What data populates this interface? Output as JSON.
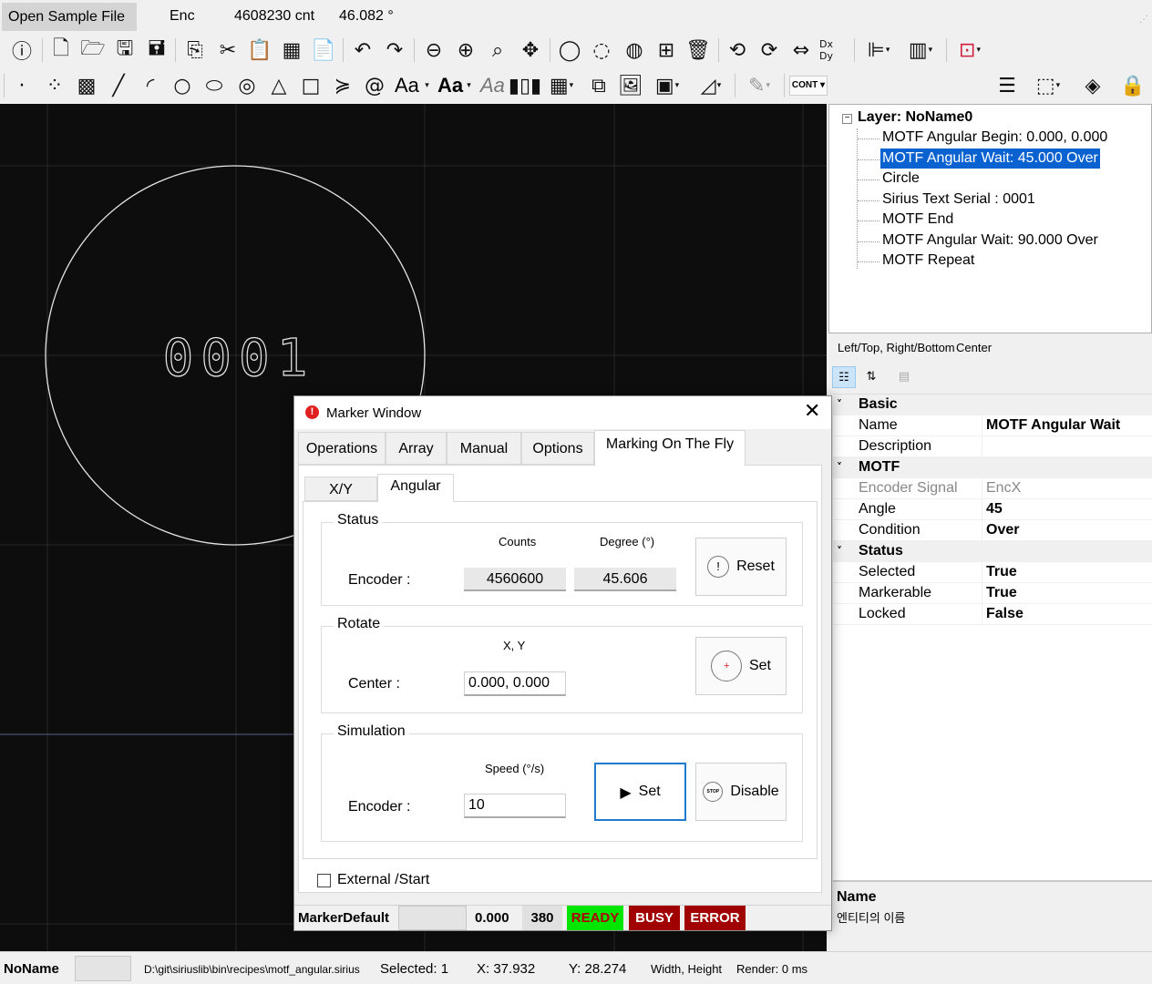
{
  "top": {
    "open_button": "Open Sample File",
    "enc_label": "Enc",
    "enc_count": "4608230 cnt",
    "enc_angle": "46.082 °"
  },
  "toolbar1": {
    "icons": [
      "info-icon",
      "new-file-icon",
      "open-folder-icon",
      "save-icon",
      "save-as-icon",
      "copy-icon",
      "cut-icon",
      "paste-icon",
      "paste-array-icon",
      "clipboard-icon",
      "undo-icon",
      "redo-icon",
      "zoom-out-icon",
      "zoom-in-icon",
      "zoom-fit-icon",
      "pan-icon",
      "select-circle-icon",
      "lasso-icon",
      "hatch-icon",
      "group-icon",
      "delete-icon",
      "rotate-ccw-icon",
      "rotate-cw-icon",
      "mirror-icon",
      "dxdy-icon",
      "align-icon",
      "distribute-icon",
      "stop-icon"
    ],
    "dxdy_label": "Dx Dy"
  },
  "toolbar2": {
    "text_tools": [
      "Aa",
      "Aa",
      "Aa"
    ],
    "cont_label": "CONT"
  },
  "canvas": {
    "text": "0001",
    "colors": {
      "bg": "#0d0d0d",
      "stroke": "#e6e6e6",
      "grid": "#262626",
      "axis": "#5b5f8a"
    }
  },
  "tree": {
    "root": "Layer: NoName0",
    "items": [
      {
        "label": "MOTF Angular Begin: 0.000, 0.000",
        "selected": false
      },
      {
        "label": "MOTF Angular Wait: 45.000 Over",
        "selected": true
      },
      {
        "label": "Circle",
        "selected": false
      },
      {
        "label": "Sirius Text Serial : 0001",
        "selected": false
      },
      {
        "label": "MOTF End",
        "selected": false
      },
      {
        "label": "MOTF Angular Wait: 90.000 Over",
        "selected": false
      },
      {
        "label": "MOTF Repeat",
        "selected": false
      }
    ]
  },
  "prop_header": {
    "a": "Left/Top, Right/Bottom",
    "b": "Center"
  },
  "props": {
    "basic": "Basic",
    "name_k": "Name",
    "name_v": "MOTF Angular Wait",
    "desc_k": "Description",
    "desc_v": "",
    "motf": "MOTF",
    "enc_k": "Encoder Signal",
    "enc_v": "EncX",
    "angle_k": "Angle",
    "angle_v": "45",
    "cond_k": "Condition",
    "cond_v": "Over",
    "status": "Status",
    "sel_k": "Selected",
    "sel_v": "True",
    "mark_k": "Markerable",
    "mark_v": "True",
    "lock_k": "Locked",
    "lock_v": "False"
  },
  "help": {
    "title": "Name",
    "desc": "엔티티의 이름"
  },
  "statusbar": {
    "name": "NoName",
    "path": "D:\\git\\siriuslib\\bin\\recipes\\motf_angular.sirius",
    "selected": "Selected: 1",
    "x": "X: 37.932",
    "y": "Y: 28.274",
    "wh": "Width, Height",
    "render": "Render: 0 ms"
  },
  "dialog": {
    "title": "Marker Window",
    "tabs": [
      "Operations",
      "Array",
      "Manual",
      "Options",
      "Marking On The Fly"
    ],
    "subtabs": [
      "X/Y",
      "Angular"
    ],
    "status_group": "Status",
    "counts_label": "Counts",
    "degree_label": "Degree (°)",
    "encoder_label": "Encoder :",
    "counts_value": "4560600",
    "degree_value": "45.606",
    "reset_label": "Reset",
    "rotate_group": "Rotate",
    "xy_label": "X, Y",
    "center_label": "Center :",
    "center_value": "0.000, 0.000",
    "set_label": "Set",
    "sim_group": "Simulation",
    "speed_label": "Speed (°/s)",
    "sim_encoder_label": "Encoder  :",
    "speed_value": "10",
    "sim_set_label": "Set",
    "disable_label": "Disable",
    "external_start": "External /Start",
    "status_bar": {
      "marker": "MarkerDefault",
      "value": "0.000",
      "count": "380",
      "ready": "READY",
      "busy": "BUSY",
      "error": "ERROR",
      "colors": {
        "ready": "#00e600",
        "busy": "#a00000",
        "error": "#a00000"
      }
    }
  }
}
